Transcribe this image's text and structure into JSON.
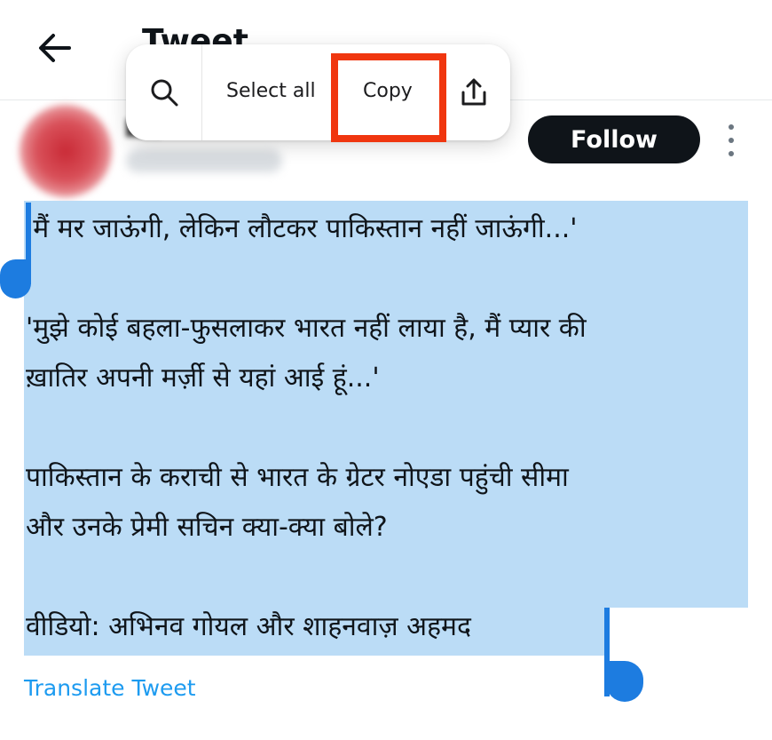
{
  "header": {
    "title": "Tweet",
    "back_icon": "arrow-left-icon"
  },
  "author": {
    "follow_label": "Follow",
    "more_icon": "more-vertical-icon"
  },
  "selection_toolbar": {
    "search_icon": "search-icon",
    "select_all_label": "Select all",
    "copy_label": "Copy",
    "share_icon": "share-icon",
    "highlight_color": "#f0360f"
  },
  "tweet": {
    "lines": [
      "'मैं मर जाऊंगी, लेकिन लौटकर पाकिस्तान नहीं जाऊंगी...'",
      "'मुझे कोई बहला-फुसलाकर भारत नहीं लाया है, मैं प्यार की",
      "ख़ातिर अपनी मर्ज़ी से यहां आई हूं...'",
      "पाकिस्तान के कराची से भारत के ग्रेटर नोएडा पहुंची सीमा",
      "और उनके प्रेमी सचिन क्या-क्या बोले?",
      "वीडियो: अभिनव गोयल और शाहनवाज़ अहमद"
    ],
    "selection_color": "#bbdcf6",
    "handle_color": "#1d7ce0"
  },
  "translate_label": "Translate Tweet"
}
